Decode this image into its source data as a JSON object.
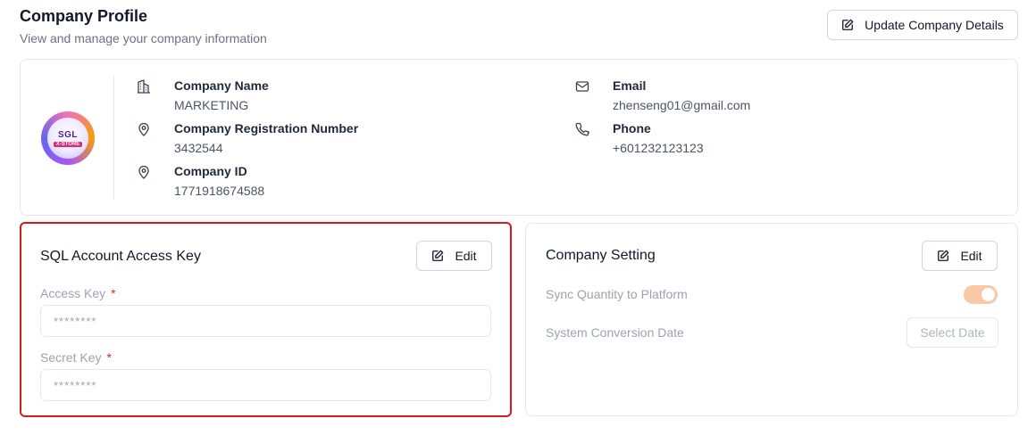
{
  "header": {
    "title": "Company Profile",
    "subtitle": "View and manage your company information",
    "update_button": "Update Company Details"
  },
  "profile": {
    "logo_text": "SGL",
    "logo_subtext": "X-STORE",
    "fields": {
      "company_name": {
        "label": "Company Name",
        "value": "MARKETING",
        "icon": "building-icon"
      },
      "registration_number": {
        "label": "Company Registration Number",
        "value": "3432544",
        "icon": "map-pin-icon"
      },
      "company_id": {
        "label": "Company ID",
        "value": "1771918674588",
        "icon": "map-pin-icon"
      },
      "email": {
        "label": "Email",
        "value": "zhenseng01@gmail.com",
        "icon": "mail-icon"
      },
      "phone": {
        "label": "Phone",
        "value": "+601232123123",
        "icon": "phone-icon"
      }
    }
  },
  "access_key_card": {
    "title": "SQL Account Access Key",
    "edit_label": "Edit",
    "access_key_label": "Access Key",
    "access_key_value": "********",
    "secret_key_label": "Secret Key",
    "secret_key_value": "********",
    "required_marker": "*"
  },
  "company_setting_card": {
    "title": "Company Setting",
    "edit_label": "Edit",
    "sync_label": "Sync Quantity to Platform",
    "sync_enabled": true,
    "conversion_date_label": "System Conversion Date",
    "select_date_label": "Select Date"
  },
  "colors": {
    "highlight_border": "#d11c1c",
    "toggle_on": "#f8c9a4",
    "required": "#dc2626"
  }
}
